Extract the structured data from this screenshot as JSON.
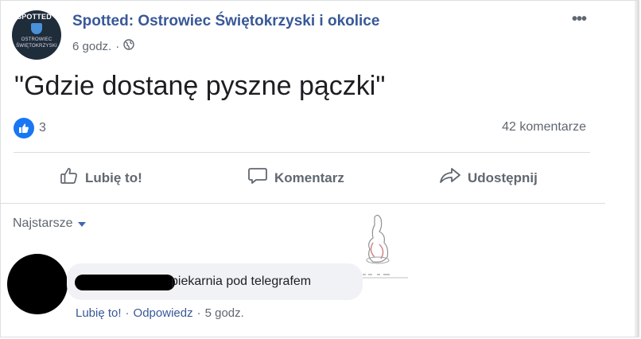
{
  "post": {
    "page_name": "Spotted: Ostrowiec Świętokrzyski i okolice",
    "time": "6 godz.",
    "separator": "·",
    "audience_icon": "globe-icon",
    "more_icon": "•••",
    "text": "\"Gdzie dostanę pyszne pączki\"",
    "avatar_text_top": "SPOTTED",
    "avatar_text_mid_1": "OSTROWIEC",
    "avatar_text_mid_2": "ŚWIĘTOKRZYSKI"
  },
  "reactions": {
    "icon": "like-icon",
    "count": "3",
    "comments": "42 komentarze"
  },
  "actions": {
    "like": "Lubię to!",
    "comment": "Komentarz",
    "share": "Udostępnij"
  },
  "comments": {
    "sort_label": "Najstarsze",
    "items": [
      {
        "author": "",
        "text": "piekarnia pod telegrafem",
        "like_link": "Lubię to!",
        "sep1": "·",
        "reply_link": "Odpowiedz",
        "sep2": "·",
        "time": "5 godz."
      }
    ]
  },
  "colors": {
    "link_blue": "#385898",
    "like_blue": "#1877f2",
    "muted": "#606770"
  }
}
